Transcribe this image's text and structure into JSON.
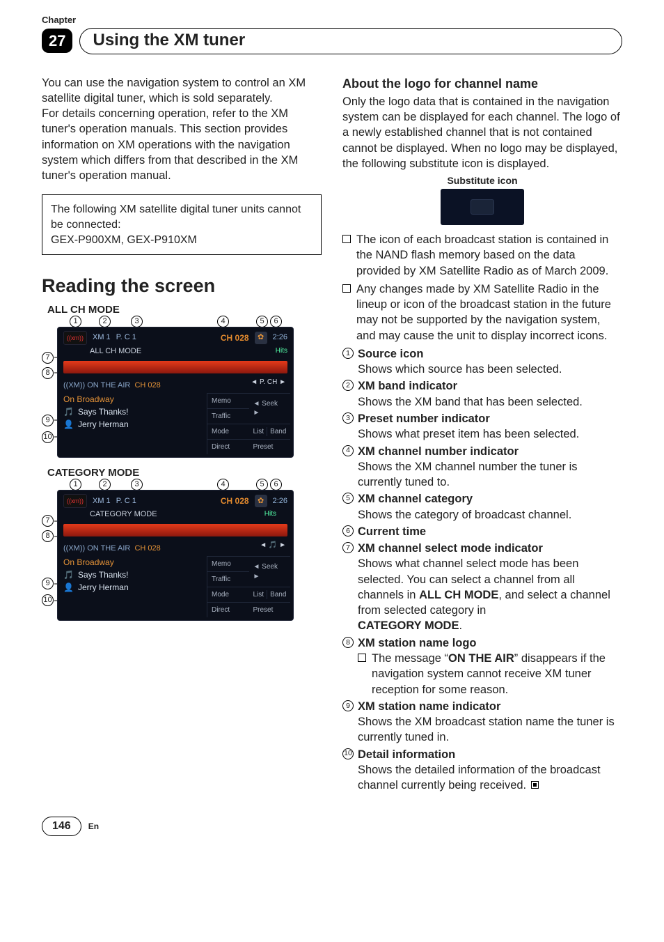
{
  "chapter_label": "Chapter",
  "chapter_number": "27",
  "section_title": "Using the XM tuner",
  "intro_p1": "You can use the navigation system to control an XM satellite digital tuner, which is sold separately.",
  "intro_p2": "For details concerning operation, refer to the XM tuner's operation manuals. This section provides information on XM operations with the navigation system which differs from that described in the XM tuner's operation manual.",
  "notice_line1": "The following XM satellite digital tuner units cannot be connected:",
  "notice_line2": "GEX-P900XM, GEX-P910XM",
  "left_heading": "Reading the screen",
  "mode_all": "ALL CH MODE",
  "mode_cat": "CATEGORY MODE",
  "screen": {
    "src": "((xm))",
    "xm_band": "XM 1",
    "preset": "P. C 1",
    "ch_top": "CH 028",
    "clock": "2:26",
    "hits": "Hits",
    "pch": "◄ P. CH ►",
    "air_prefix": "((XM)) ON THE AIR",
    "air_ch": "CH 028",
    "station": "On Broadway",
    "detail1": "Says Thanks!",
    "detail2": "Jerry Herman",
    "btn_memo": "Memo",
    "btn_traffic": "Traffic",
    "btn_seek": "◄ Seek ►",
    "btn_mode": "Mode",
    "btn_list": "List",
    "btn_band": "Band",
    "btn_direct": "Direct",
    "btn_preset": "Preset",
    "modeline_all": "ALL CH MODE",
    "modeline_cat": "CATEGORY MODE"
  },
  "callouts": [
    "1",
    "2",
    "3",
    "4",
    "5",
    "6",
    "7",
    "8",
    "9",
    "10"
  ],
  "logo_heading": "About the logo for channel name",
  "logo_para": "Only the logo data that is contained in the navigation system can be displayed for each channel. The logo of a newly established channel that is not contained cannot be displayed. When no logo may be displayed, the following substitute icon is displayed.",
  "substitute_label": "Substitute icon",
  "bullets": [
    "The icon of each broadcast station is contained in the NAND flash memory based on the data provided by XM Satellite Radio as of March 2009.",
    "Any changes made by XM Satellite Radio in the lineup or icon of the broadcast station in the future may not be supported by the navigation system, and may cause the unit to display incorrect icons."
  ],
  "defs": [
    {
      "n": "1",
      "t": "Source icon",
      "d": "Shows which source has been selected."
    },
    {
      "n": "2",
      "t": "XM band indicator",
      "d": "Shows the XM band that has been selected."
    },
    {
      "n": "3",
      "t": "Preset number indicator",
      "d": "Shows what preset item has been selected."
    },
    {
      "n": "4",
      "t": "XM channel number indicator",
      "d": "Shows the XM channel number the tuner is currently tuned to."
    },
    {
      "n": "5",
      "t": "XM channel category",
      "d": "Shows the category of broadcast channel."
    },
    {
      "n": "6",
      "t": "Current time",
      "d": ""
    },
    {
      "n": "7",
      "t": "XM channel select mode indicator",
      "d7": true
    },
    {
      "n": "8",
      "t": "XM station name logo",
      "nested": true
    },
    {
      "n": "9",
      "t": "XM station name indicator",
      "d": "Shows the XM broadcast station name the tuner is currently tuned in."
    },
    {
      "n": "10",
      "t": "Detail information",
      "d": "Shows the detailed information of the broadcast channel currently being received."
    }
  ],
  "def7_pre": "Shows what channel select mode has been selected. You can select a channel from all channels in ",
  "def7_b1": "ALL CH MODE",
  "def7_mid": ", and select a channel from selected category in ",
  "def7_b2": "CATEGORY MODE",
  "def7_post": ".",
  "def8_nested_pre": "The message “",
  "def8_nested_b": "ON THE AIR",
  "def8_nested_post": "” disappears if the navigation system cannot receive XM tuner reception for some reason.",
  "page_number": "146",
  "lang": "En"
}
